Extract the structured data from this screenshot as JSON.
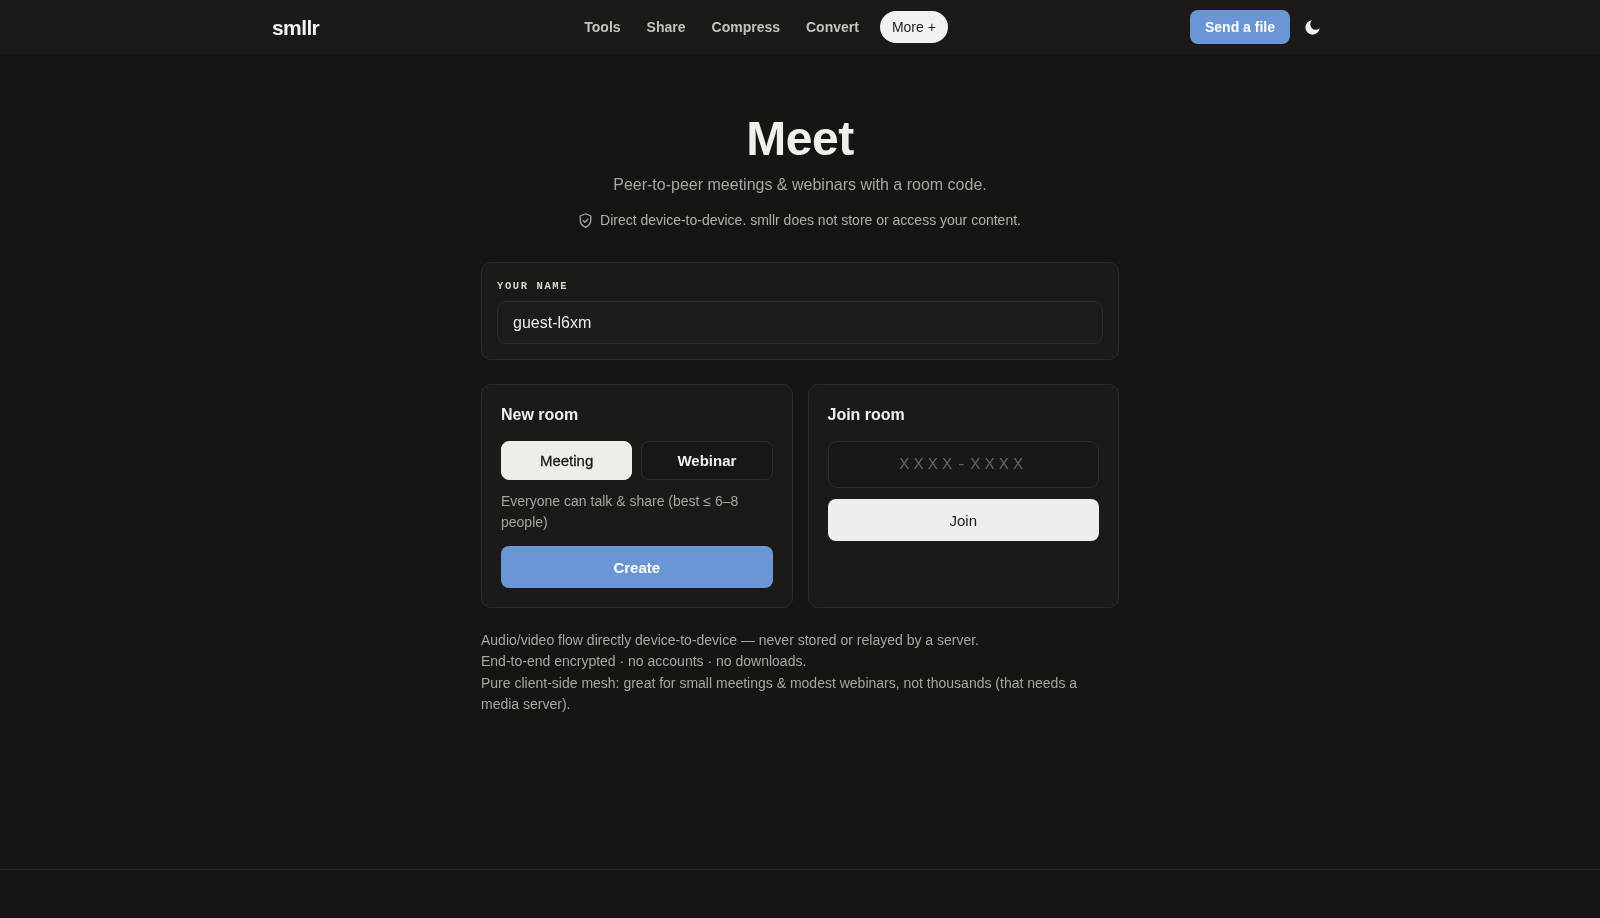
{
  "header": {
    "logo": "smllr",
    "nav": [
      {
        "label": "Tools",
        "kind": "link"
      },
      {
        "label": "Share",
        "kind": "link"
      },
      {
        "label": "Compress",
        "kind": "link"
      },
      {
        "label": "Convert",
        "kind": "link"
      },
      {
        "label": "More +",
        "kind": "menu"
      }
    ],
    "cta": "Send a file"
  },
  "hero": {
    "title": "Meet",
    "subtitle": "Peer-to-peer meetings & webinars with a room code.",
    "privacy_note": "Direct device-to-device. smllr does not store or access your content."
  },
  "name_card": {
    "label": "YOUR NAME",
    "value": "guest-l6xm"
  },
  "new_room": {
    "title": "New room",
    "modes": [
      {
        "label": "Meeting",
        "selected": true
      },
      {
        "label": "Webinar",
        "selected": false
      }
    ],
    "description": "Everyone can talk & share (best ≤ 6–8 people)",
    "button": "Create"
  },
  "join_room": {
    "title": "Join room",
    "code_field": {
      "placeholder": "XXXX-XXXX"
    },
    "button": "Join"
  },
  "notes": [
    "Audio/video flow directly device-to-device — never stored or relayed by a server.",
    "End-to-end encrypted · no accounts · no downloads.",
    "Pure client-side mesh: great for small meetings & modest webinars, not thousands (that needs a media server)."
  ]
}
